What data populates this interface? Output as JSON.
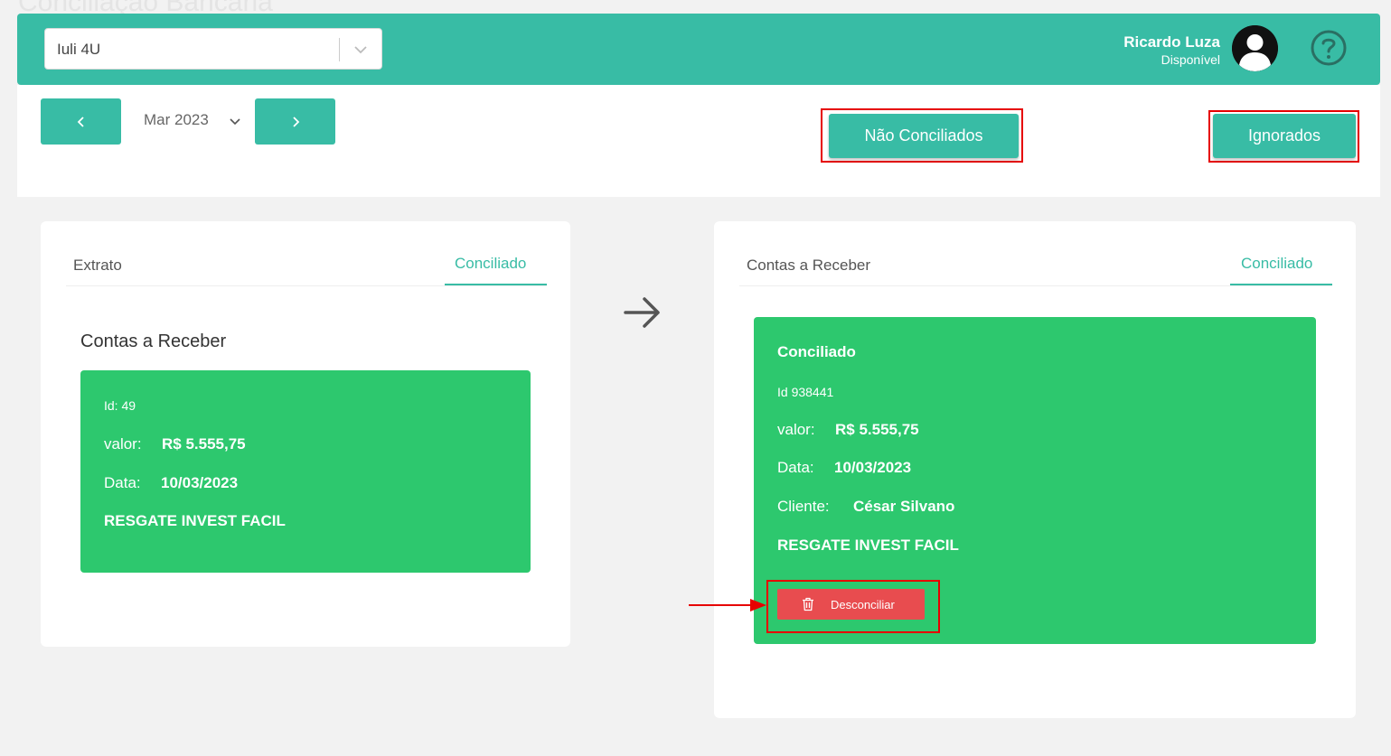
{
  "page": {
    "title": "Conciliação Bancária"
  },
  "topbar": {
    "company": "Iuli 4U",
    "user_name": "Ricardo Luza",
    "user_status": "Disponível"
  },
  "toolbar": {
    "prev_label": "‹",
    "next_label": "›",
    "month": "Mar 2023",
    "nao_conciliados": "Não Conciliados",
    "ignorados": "Ignorados"
  },
  "left_panel": {
    "tab_left": "Extrato",
    "tab_active": "Conciliado",
    "section_title": "Contas a Receber",
    "card": {
      "id": "Id: 49",
      "valor_label": "valor:",
      "valor": "R$ 5.555,75",
      "data_label": "Data:",
      "data": "10/03/2023",
      "descricao": "RESGATE INVEST FACIL"
    }
  },
  "right_panel": {
    "tab_left": "Contas a Receber",
    "tab_active": "Conciliado",
    "card": {
      "status": "Conciliado",
      "id": "Id 938441",
      "valor_label": "valor:",
      "valor": "R$ 5.555,75",
      "data_label": "Data:",
      "data": "10/03/2023",
      "cliente_label": "Cliente:",
      "cliente": "César Silvano",
      "descricao": "RESGATE INVEST FACIL",
      "desconciliar": "Desconciliar"
    }
  },
  "colors": {
    "brand": "#38bca5",
    "card": "#2dc86e",
    "danger": "#e84c4f",
    "highlight": "#e60000"
  },
  "icons": [
    "chevron-down-icon",
    "user-avatar-icon",
    "help-circle-icon",
    "arrow-right-icon",
    "trash-icon"
  ]
}
